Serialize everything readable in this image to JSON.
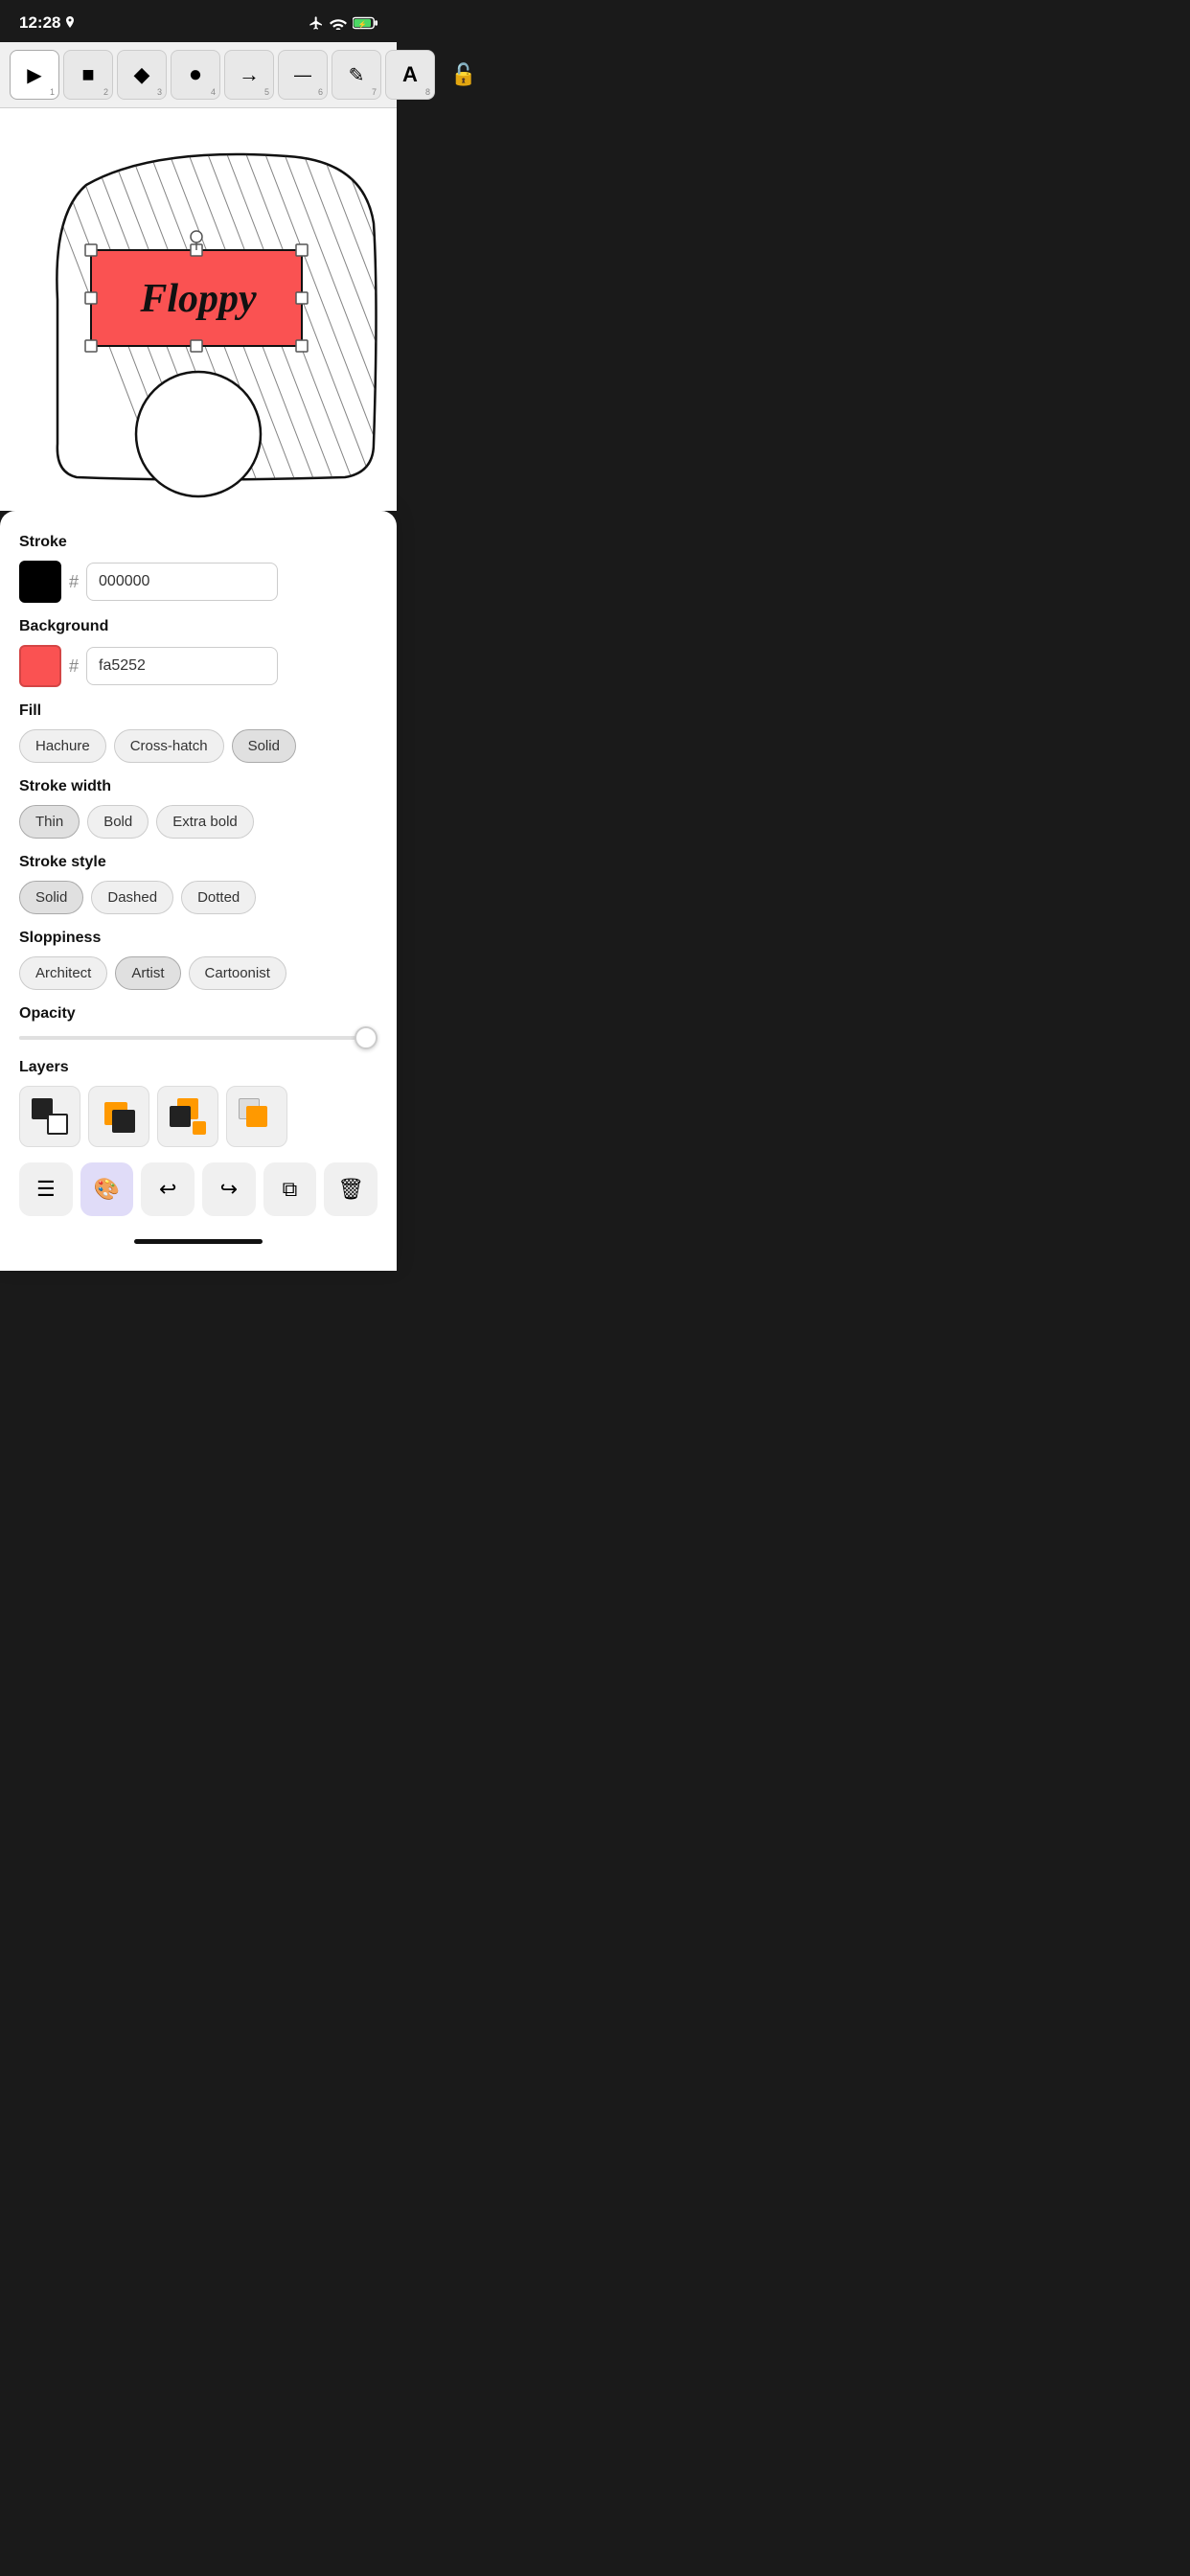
{
  "statusBar": {
    "time": "12:28",
    "locationIcon": true
  },
  "toolbar": {
    "tools": [
      {
        "id": "select",
        "icon": "▶",
        "num": "1",
        "active": true
      },
      {
        "id": "rect",
        "icon": "■",
        "num": "2"
      },
      {
        "id": "diamond",
        "icon": "◆",
        "num": "3"
      },
      {
        "id": "ellipse",
        "icon": "●",
        "num": "4"
      },
      {
        "id": "arrow",
        "icon": "→",
        "num": "5"
      },
      {
        "id": "line",
        "icon": "—",
        "num": "6"
      },
      {
        "id": "pen",
        "icon": "✎",
        "num": "7"
      },
      {
        "id": "text",
        "icon": "A",
        "num": "8"
      },
      {
        "id": "lock",
        "icon": "🔓",
        "num": ""
      }
    ]
  },
  "panel": {
    "stroke": {
      "label": "Stroke",
      "color": "#000000",
      "hex": "000000"
    },
    "background": {
      "label": "Background",
      "color": "#fa5252",
      "hex": "fa5252"
    },
    "fill": {
      "label": "Fill",
      "options": [
        "Hachure",
        "Cross-hatch",
        "Solid"
      ],
      "active": "Solid"
    },
    "strokeWidth": {
      "label": "Stroke width",
      "options": [
        "Thin",
        "Bold",
        "Extra bold"
      ],
      "active": "Thin"
    },
    "strokeStyle": {
      "label": "Stroke style",
      "options": [
        "Solid",
        "Dashed",
        "Dotted"
      ],
      "active": "Solid"
    },
    "sloppiness": {
      "label": "Sloppiness",
      "options": [
        "Architect",
        "Artist",
        "Cartoonist"
      ],
      "active": "Artist"
    },
    "opacity": {
      "label": "Opacity",
      "value": 100
    },
    "layers": {
      "label": "Layers"
    }
  },
  "actionBar": {
    "buttons": [
      {
        "id": "hamburger",
        "icon": "☰"
      },
      {
        "id": "palette",
        "icon": "🎨",
        "active": true
      },
      {
        "id": "undo",
        "icon": "↩"
      },
      {
        "id": "redo",
        "icon": "↪"
      },
      {
        "id": "duplicate",
        "icon": "⧉"
      },
      {
        "id": "delete",
        "icon": "🗑"
      }
    ]
  }
}
